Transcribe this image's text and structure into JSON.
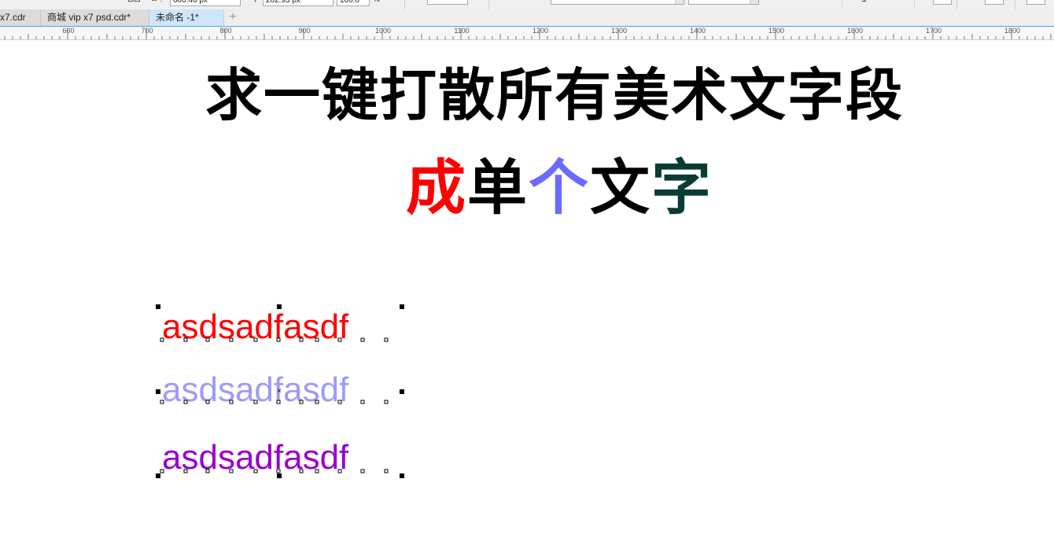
{
  "propbar": {
    "width_value": "600.46 px",
    "height_value": "202.93 px",
    "scale_value": "100.0",
    "percent": "%"
  },
  "tabs": [
    {
      "label": "x7.cdr"
    },
    {
      "label": "商城 vip x7 psd.cdr*"
    },
    {
      "label": "未命名 -1*",
      "active": true
    }
  ],
  "tab_add": "+",
  "ruler": {
    "labels": [
      "600",
      "700",
      "800",
      "900",
      "1000",
      "1100",
      "1200",
      "1300",
      "1400",
      "1500",
      "1600",
      "1700",
      "1800"
    ]
  },
  "canvas": {
    "title": "求一键打散所有美术文字段",
    "subtitle_chars": [
      {
        "char": "成",
        "color": "#ff0000"
      },
      {
        "char": "单",
        "color": "#000000"
      },
      {
        "char": "个",
        "color": "#6b6bff"
      },
      {
        "char": "文",
        "color": "#000000"
      },
      {
        "char": "字",
        "color": "#0b3b35"
      }
    ],
    "samples": [
      {
        "text": "asdsadfasdf",
        "color": "#ff0000"
      },
      {
        "text": "asdsadfasdf",
        "color": "#9c9cf6"
      },
      {
        "text": "asdsadfasdf",
        "color": "#9900cc"
      }
    ],
    "center_mark": "×"
  },
  "colors": {
    "active_tab": "#cfe6f9",
    "ruler_accent": "#3fa9e6"
  }
}
